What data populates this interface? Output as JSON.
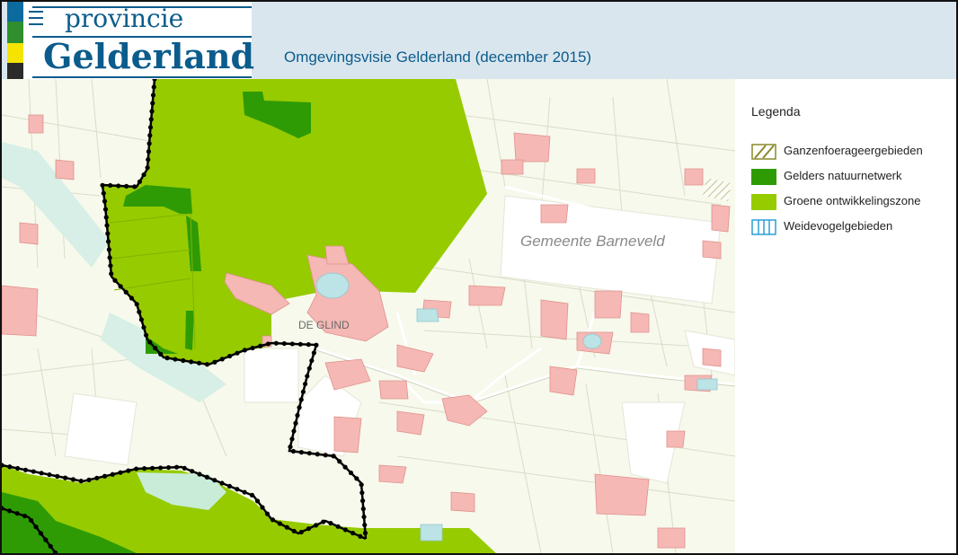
{
  "logo": {
    "line1": "provincie",
    "line2": "Gelderland",
    "stripe_colors": [
      "#0b6a9e",
      "#2f8f2f",
      "#f5e400",
      "#2b2b2b"
    ]
  },
  "app": {
    "title": "Omgevingsvisie Gelderland (december 2015)"
  },
  "map": {
    "labels": {
      "municipality": "Gemeente  Barneveld",
      "village": "DE GLIND"
    },
    "colors": {
      "base": "#f7f9ec",
      "field": "#fbfbf0",
      "built": "#f5b8b4",
      "water": "#bce3e6",
      "green_dev": "#96cb00",
      "nature_network": "#2e9b05",
      "road": "#ffffff",
      "boundary": "#000000",
      "meadow": "#c8ecd8"
    }
  },
  "legend": {
    "title": "Legenda",
    "items": [
      {
        "label": "Ganzenfoerageergebieden",
        "swatch": "hatched",
        "color": "#8a8a2a"
      },
      {
        "label": "Gelders natuurnetwerk",
        "swatch": "solid",
        "color": "#2e9b05"
      },
      {
        "label": "Groene ontwikkelingszone",
        "swatch": "solid",
        "color": "#96cb00"
      },
      {
        "label": "Weidevogelgebieden",
        "swatch": "vlines",
        "color": "#2a9fd8"
      }
    ]
  }
}
